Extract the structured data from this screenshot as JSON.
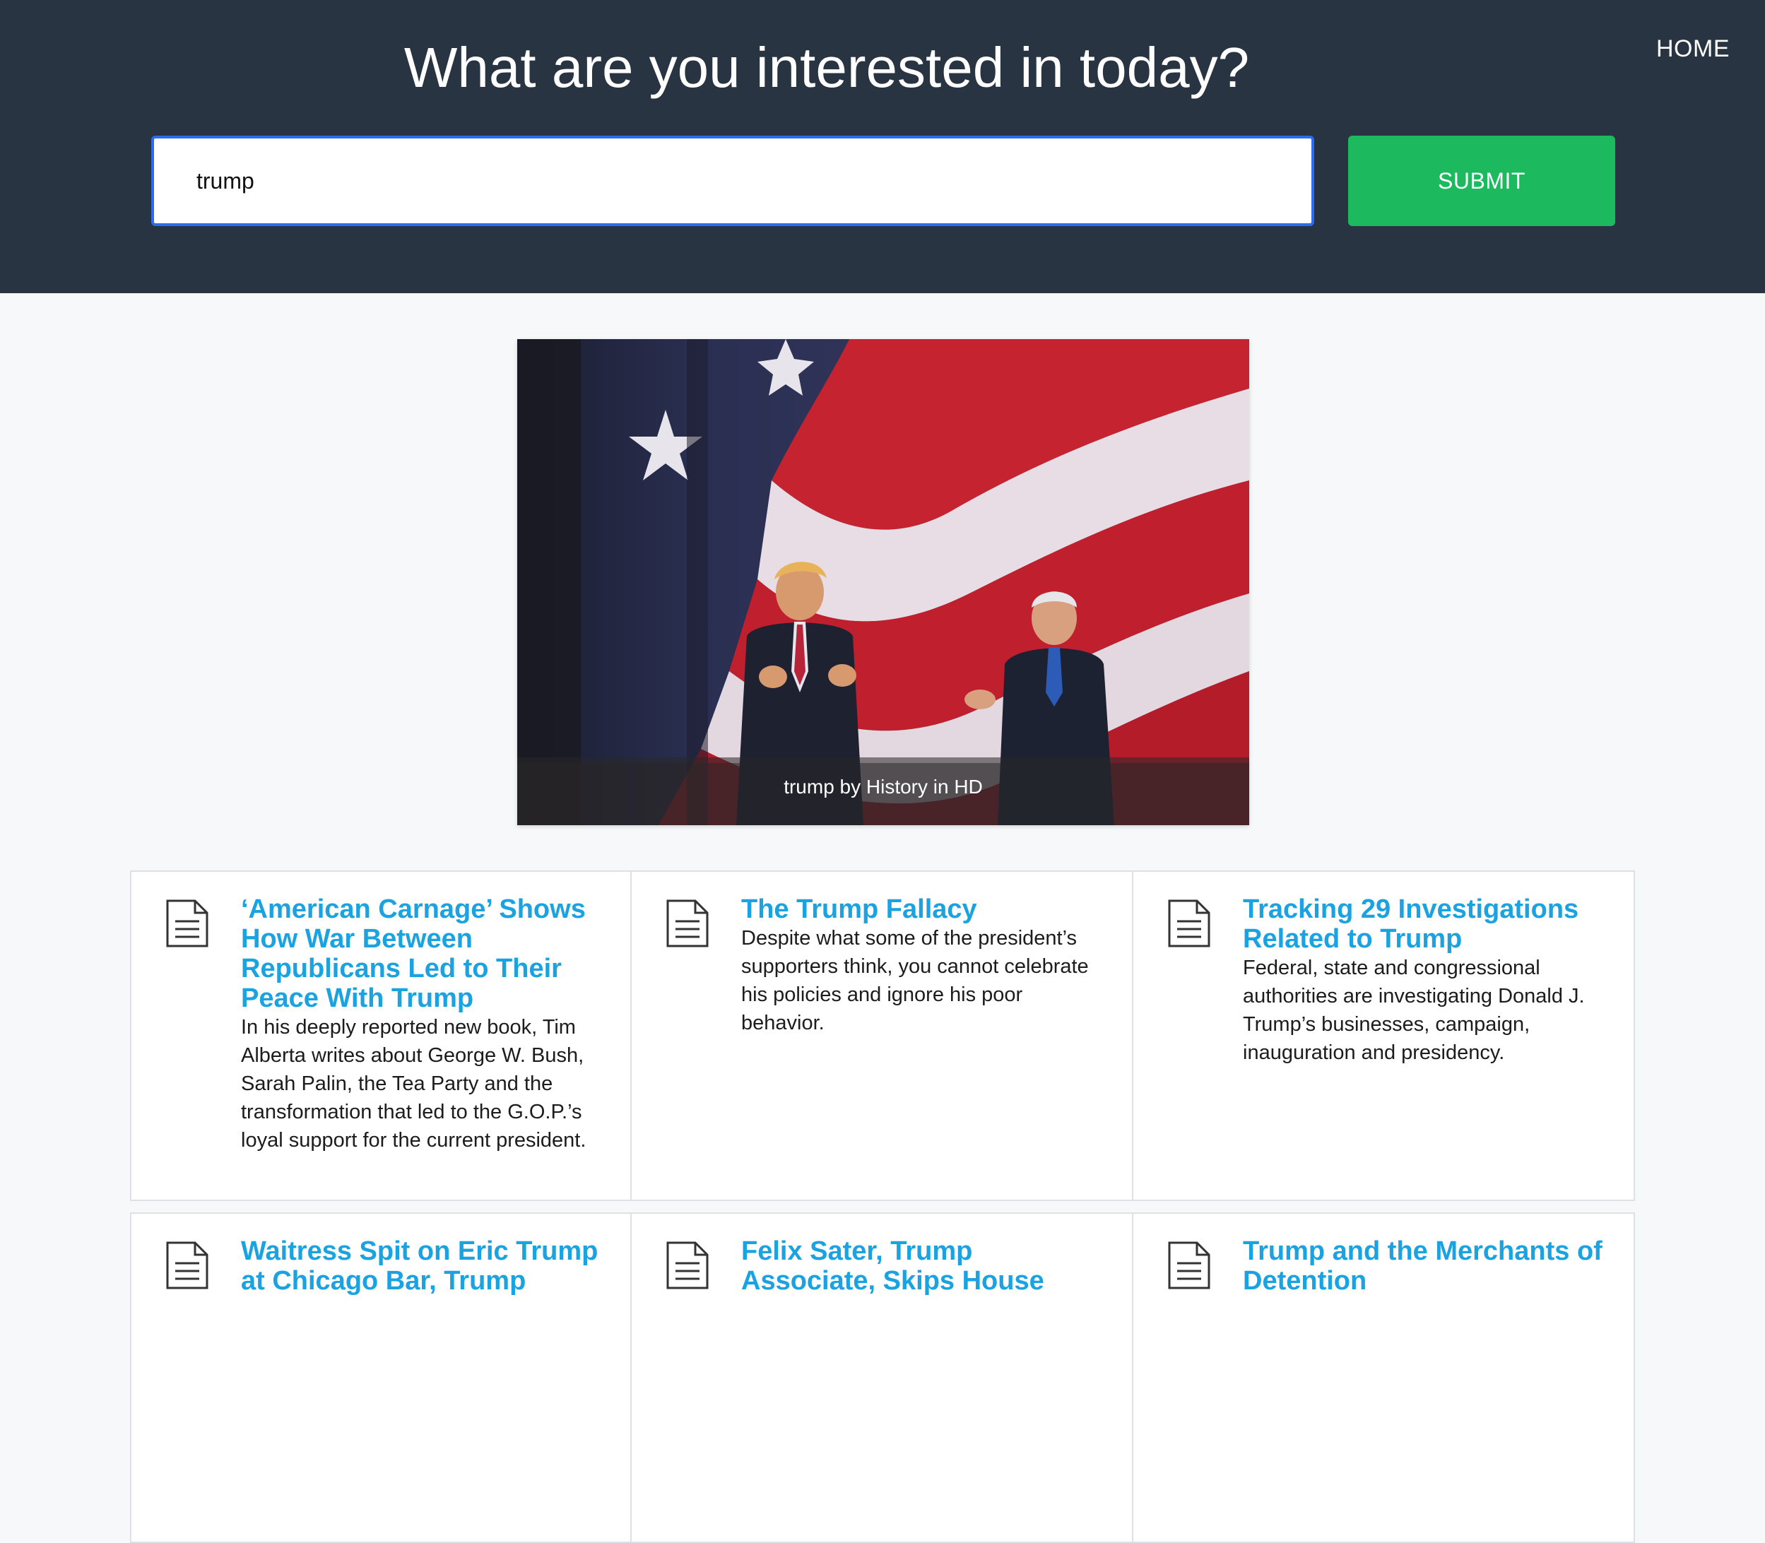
{
  "header": {
    "title": "What are you interested in today?",
    "home_label": "HOME",
    "search_value": "trump",
    "submit_label": "SUBMIT"
  },
  "hero": {
    "caption": "trump by History in HD"
  },
  "colors": {
    "header_bg": "#283441",
    "submit_bg": "#1db95e",
    "link": "#1aa3e0",
    "input_border": "#2a6df0"
  },
  "articles": [
    {
      "icon": "document-icon",
      "title": "‘American Carnage’ Shows How War Between Republicans Led to Their Peace With Trump",
      "description": "In his deeply reported new book, Tim Alberta writes about George W. Bush, Sarah Palin, the Tea Party and the transformation that led to the G.O.P.’s loyal support for the current president."
    },
    {
      "icon": "document-icon",
      "title": "The Trump Fallacy",
      "description": "Despite what some of the president’s supporters think, you cannot celebrate his policies and ignore his poor behavior."
    },
    {
      "icon": "document-icon",
      "title": "Tracking 29 Investigations Related to Trump",
      "description": "Federal, state and congressional authorities are investigating Donald J. Trump’s businesses, campaign, inauguration and presidency."
    },
    {
      "icon": "document-icon",
      "title": "Waitress Spit on Eric Trump at Chicago Bar, Trump",
      "description": ""
    },
    {
      "icon": "document-icon",
      "title": "Felix Sater, Trump Associate, Skips House",
      "description": ""
    },
    {
      "icon": "document-icon",
      "title": "Trump and the Merchants of Detention",
      "description": ""
    }
  ]
}
